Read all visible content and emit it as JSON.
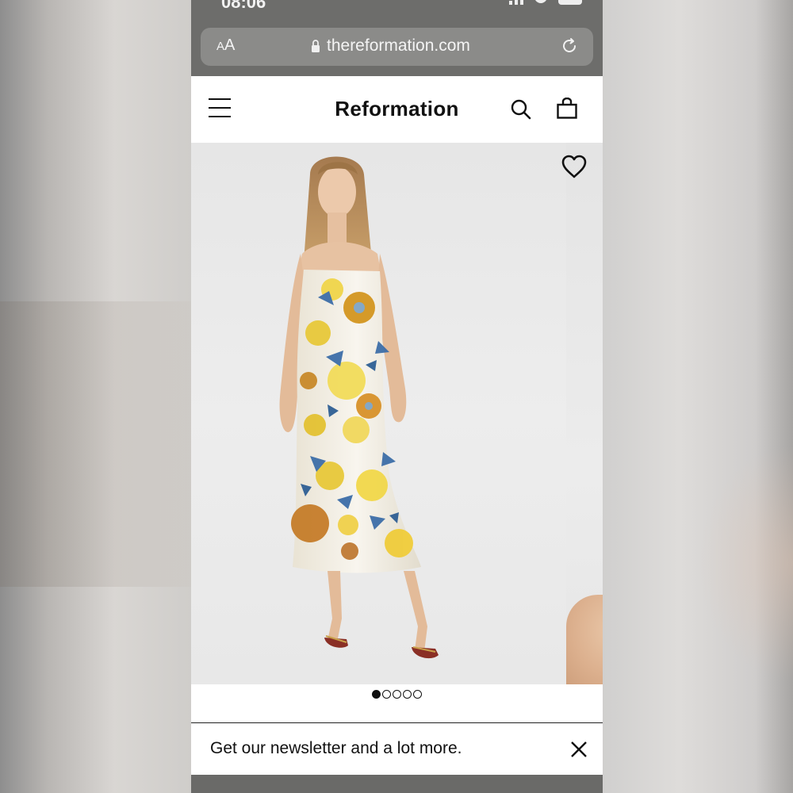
{
  "status_bar": {
    "time": "08:06"
  },
  "browser": {
    "text_size_label_small": "A",
    "text_size_label_large": "A",
    "url": "thereformation.com",
    "icons": [
      "lock-icon",
      "reload-icon"
    ]
  },
  "header": {
    "logo": "Reformation",
    "icons": [
      "menu-icon",
      "search-icon",
      "shopping-bag-icon"
    ]
  },
  "product": {
    "image_alt": "Model wearing strapless floral satin midi dress",
    "wishlist_icon": "heart-icon",
    "carousel": {
      "total": 5,
      "active_index": 0
    }
  },
  "newsletter": {
    "text": "Get our newsletter and a lot more.",
    "close_icon": "close-icon"
  },
  "colors": {
    "browser_chrome": "#6d6d6b",
    "url_pill": "#8b8b89",
    "text": "#111111"
  }
}
